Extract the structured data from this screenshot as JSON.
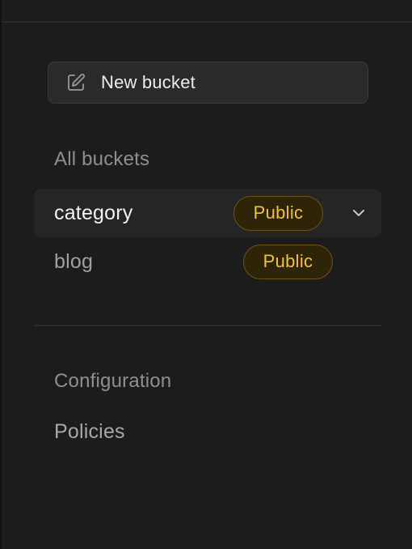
{
  "sidebar": {
    "new_bucket_label": "New bucket",
    "new_bucket_icon": "edit-icon",
    "all_buckets_title": "All buckets",
    "buckets": [
      {
        "name": "category",
        "badge": "Public",
        "active": true,
        "menu_icon": "chevron-down-icon"
      },
      {
        "name": "blog",
        "badge": "Public",
        "active": false
      }
    ],
    "configuration_title": "Configuration",
    "policies_label": "Policies"
  },
  "colors": {
    "background": "#1c1c1c",
    "button_bg": "#2a2a2a",
    "active_row_bg": "#252525",
    "badge_text": "#f0c144",
    "badge_bg": "#2e2509",
    "badge_border": "#6b5518",
    "muted_text": "#8f8f8f"
  }
}
